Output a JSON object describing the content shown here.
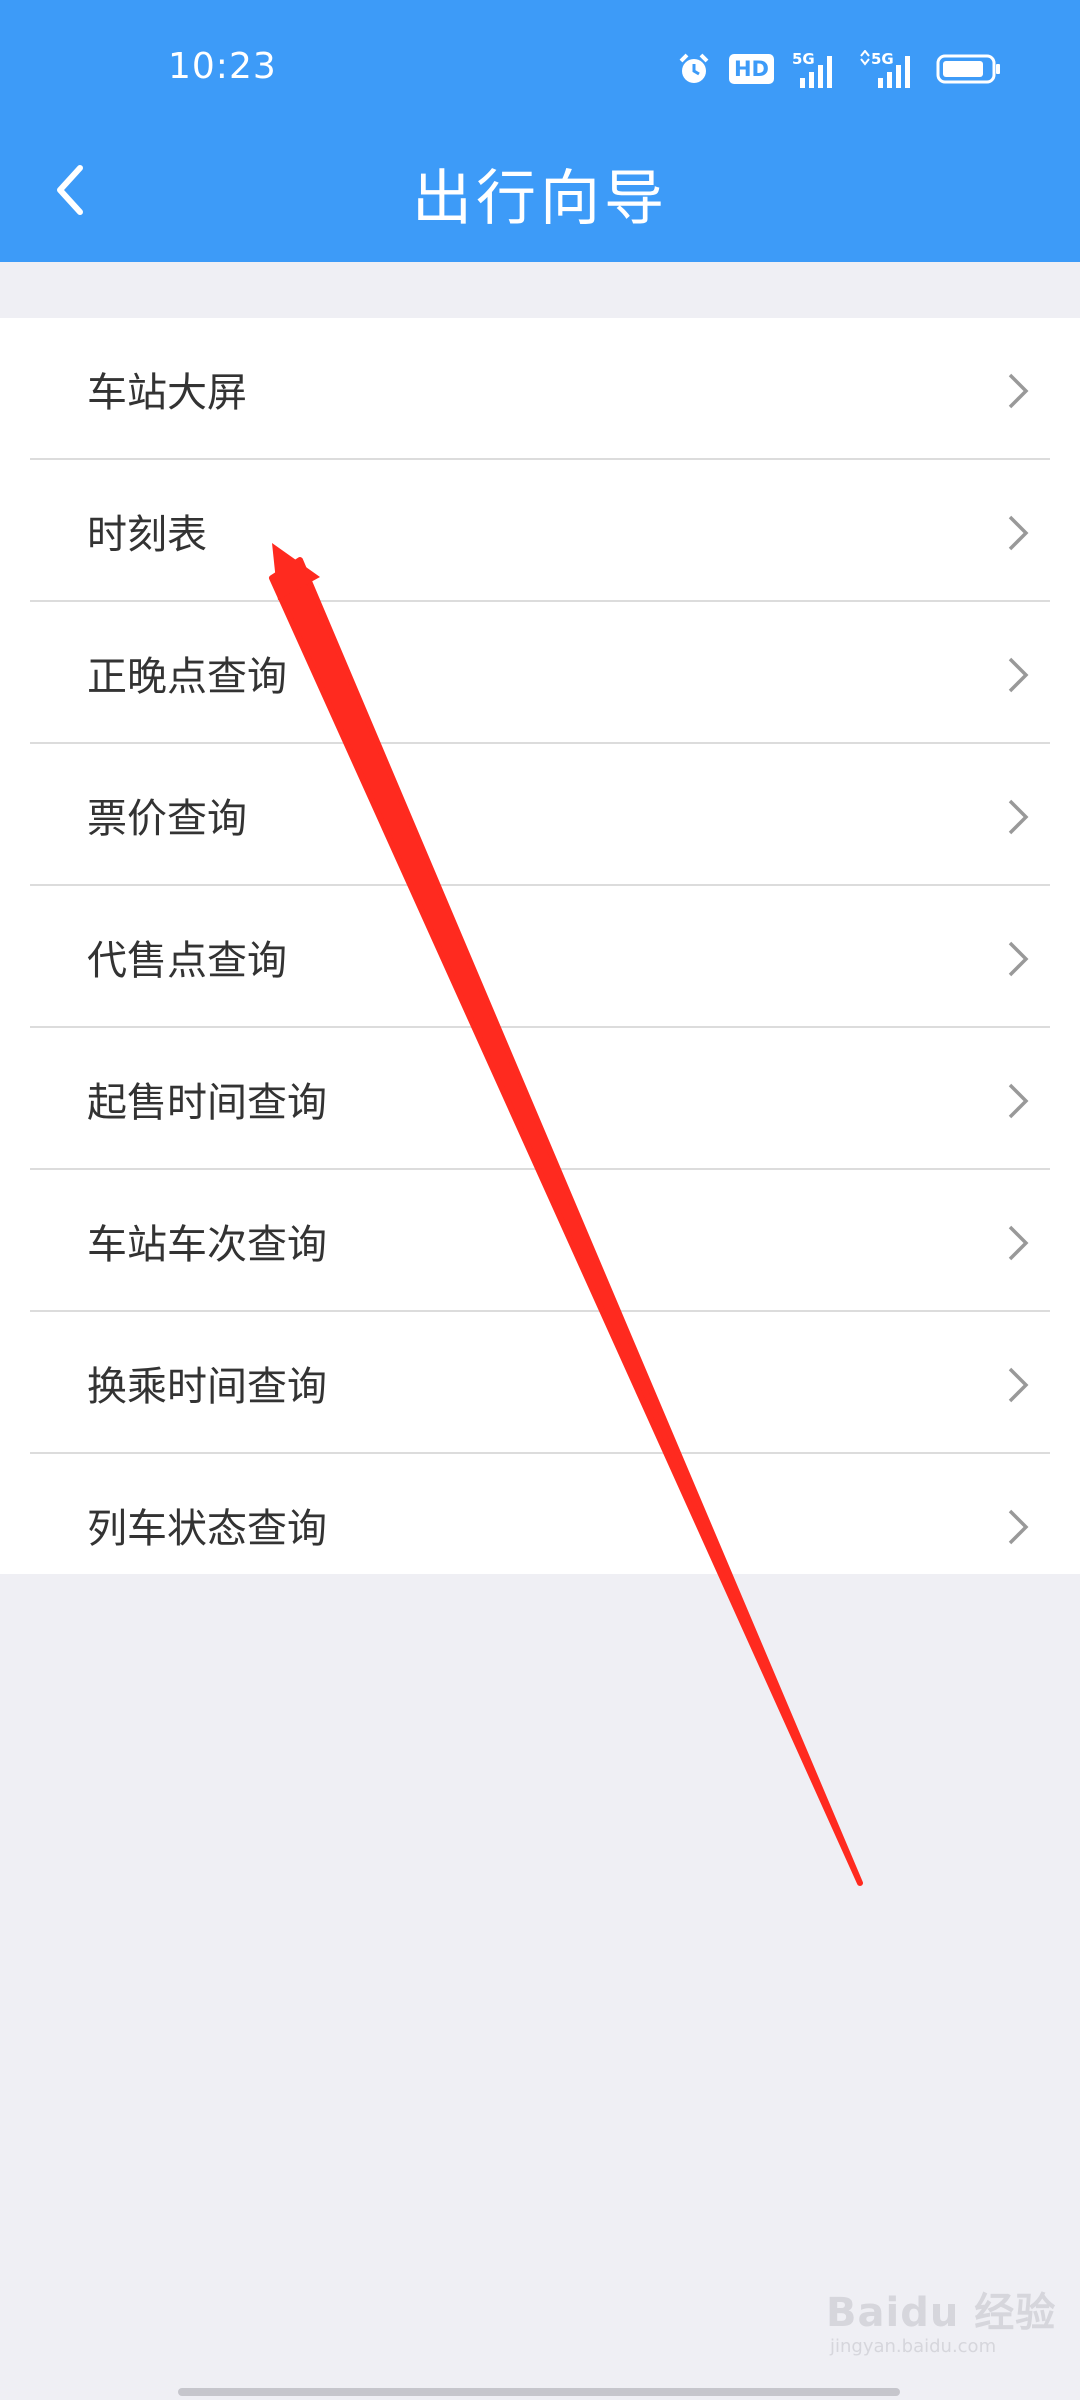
{
  "status_bar": {
    "time": "10:23",
    "icons": [
      "alarm-icon",
      "hd-voice-icon",
      "5g-signal-icon",
      "5g-signal-icon",
      "battery-icon"
    ],
    "hd_label": "HD",
    "net_label": "5G"
  },
  "header": {
    "title": "出行向导",
    "back_icon": "chevron-left-icon",
    "background": "#3d9bf8"
  },
  "menu": {
    "items": [
      {
        "label": "车站大屏"
      },
      {
        "label": "时刻表"
      },
      {
        "label": "正晚点查询"
      },
      {
        "label": "票价查询"
      },
      {
        "label": "代售点查询"
      },
      {
        "label": "起售时间查询"
      },
      {
        "label": "车站车次查询"
      },
      {
        "label": "换乘时间查询"
      },
      {
        "label": "列车状态查询"
      }
    ],
    "chevron_icon": "chevron-right-icon"
  },
  "annotation": {
    "color": "#ff2a1f",
    "target": "时刻表"
  },
  "watermark": {
    "main": "Baidu 经验",
    "sub": "jingyan.baidu.com"
  }
}
